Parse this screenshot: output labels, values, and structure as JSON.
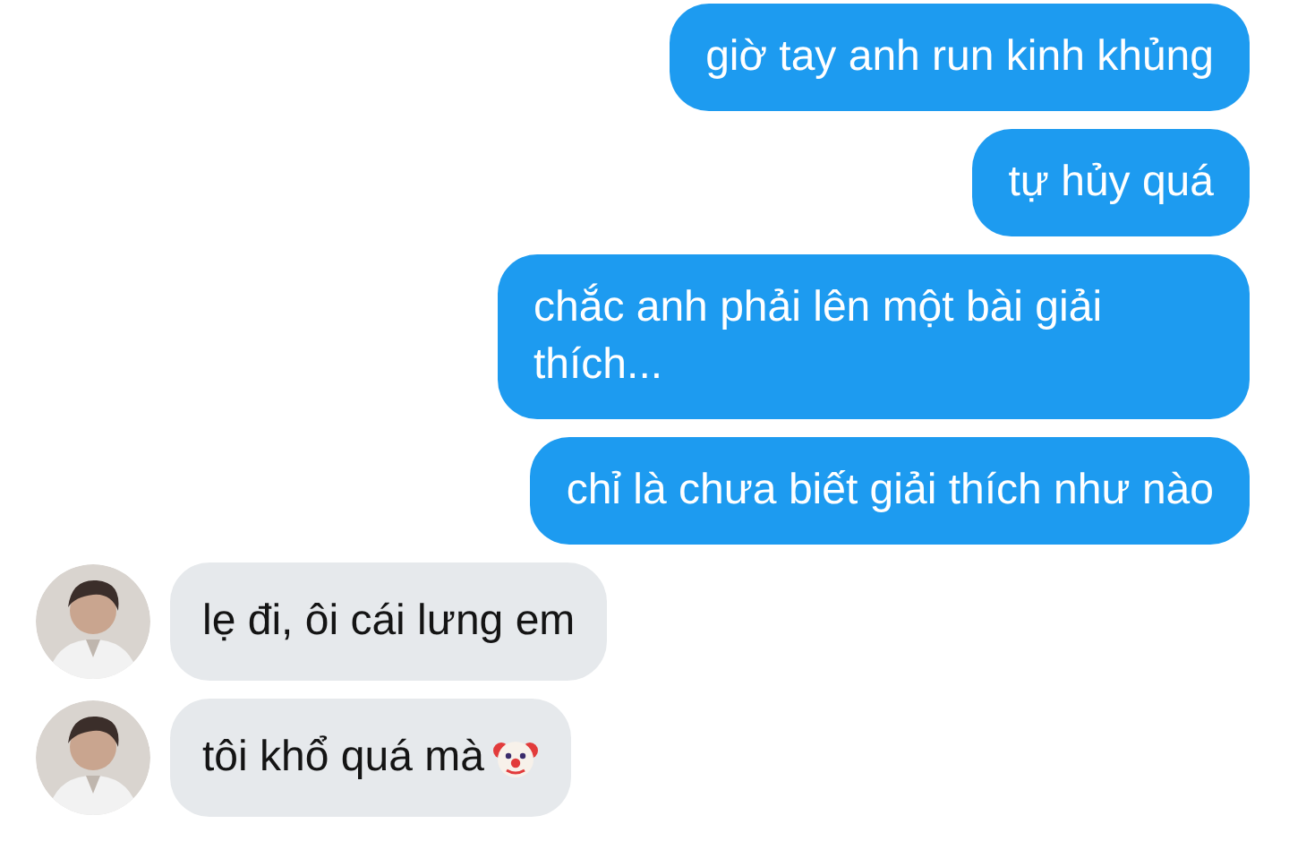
{
  "messages": [
    {
      "kind": "outgoing",
      "text": "giờ tay anh run kinh khủng"
    },
    {
      "kind": "outgoing",
      "text": "tự hủy quá"
    },
    {
      "kind": "outgoing",
      "text": "chắc anh phải lên một bài giải thích..."
    },
    {
      "kind": "outgoing",
      "text": "chỉ là chưa biết giải thích như nào"
    },
    {
      "kind": "incoming",
      "text": "lẹ đi, ôi cái lưng em",
      "emoji": false
    },
    {
      "kind": "incoming",
      "text": "tôi khổ quá mà",
      "emoji": true
    }
  ]
}
